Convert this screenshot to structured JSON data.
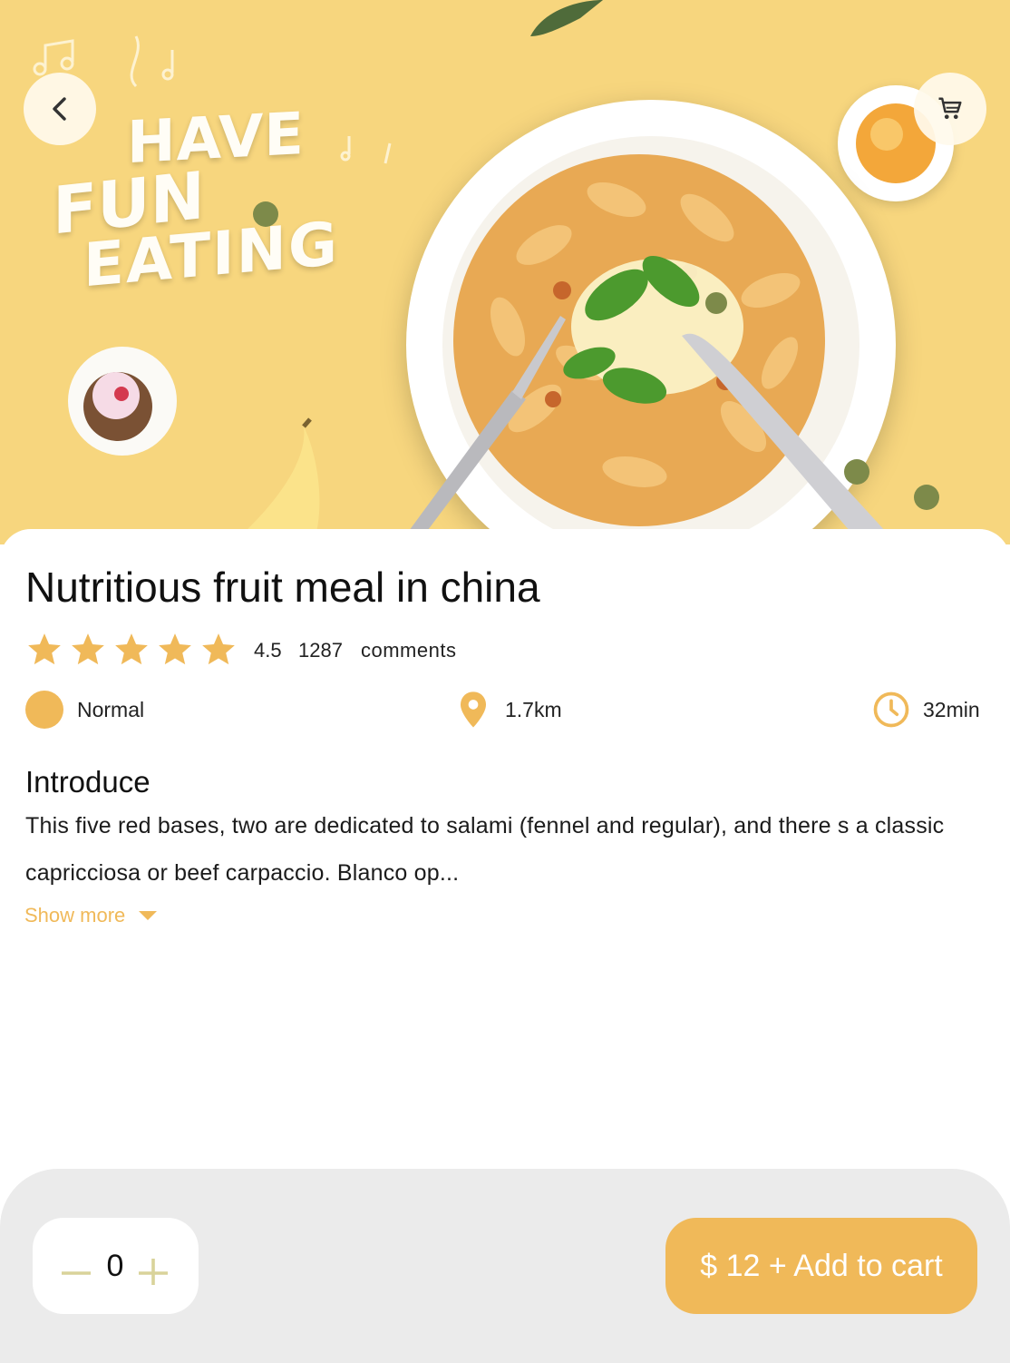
{
  "hero": {
    "banner_text": [
      "HAVE",
      "FUN",
      "EATING"
    ]
  },
  "dish": {
    "title": "Nutritious fruit meal in china",
    "rating": 4.5,
    "rating_label": "4.5",
    "stars_filled": 5,
    "comment_count": "1287",
    "comment_word": "comments"
  },
  "meta": {
    "level": "Normal",
    "distance": "1.7km",
    "time": "32min"
  },
  "introduce": {
    "heading": "Introduce",
    "body": "This five red bases, two are dedicated to salami (fennel and regular), and there s a classic capricciosa or beef carpaccio. Blanco op...",
    "show_more": "Show more"
  },
  "cart": {
    "quantity": "0",
    "add_label": "$ 12 + Add to cart"
  },
  "icons": {
    "back": "chevron-left-icon",
    "cart": "shopping-cart-icon",
    "star": "star-icon",
    "level": "dot-icon",
    "distance": "location-pin-icon",
    "time": "clock-icon",
    "show_more": "caret-down-icon",
    "minus": "minus-icon",
    "plus": "plus-icon"
  },
  "colors": {
    "accent": "#f0b959",
    "hero_background": "#f7d67e",
    "bottom_bar": "#ebebeb",
    "stepper_icon": "#d9d39a"
  }
}
